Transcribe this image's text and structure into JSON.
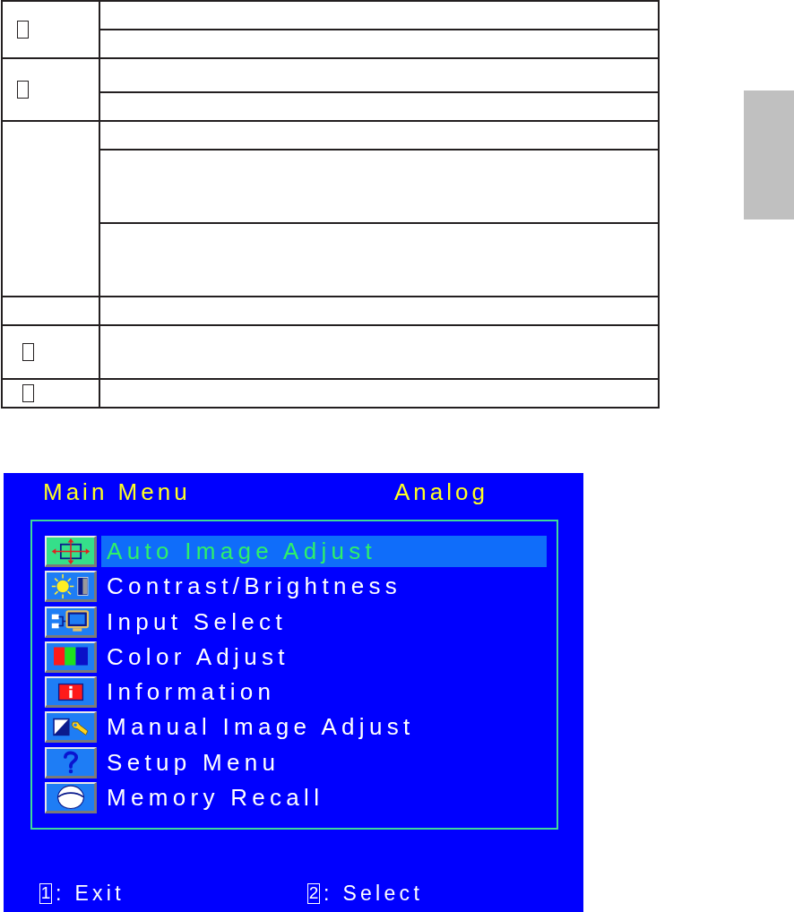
{
  "table": {
    "rows": [
      {
        "marker": true,
        "parts": [
          {
            "kind": "line"
          },
          {
            "kind": "line"
          }
        ]
      },
      {
        "marker": true,
        "parts": [
          {
            "kind": "line_tall"
          },
          {
            "kind": "line"
          }
        ]
      },
      {
        "marker": false,
        "parts": [
          {
            "kind": "line"
          },
          {
            "kind": "block_tall"
          },
          {
            "kind": "block_tall"
          }
        ]
      },
      {
        "marker": false,
        "parts": [
          {
            "kind": "line"
          }
        ]
      },
      {
        "marker": true,
        "parts": [
          {
            "kind": "block"
          }
        ]
      },
      {
        "marker": true,
        "parts": [
          {
            "kind": "line"
          }
        ]
      }
    ]
  },
  "osd_menu": {
    "title": "Main Menu",
    "source": "Analog",
    "items": [
      {
        "kind": "crosshair",
        "label": "Auto Image Adjust",
        "selected": true
      },
      {
        "kind": "sun",
        "label": "Contrast/Brightness",
        "selected": false
      },
      {
        "kind": "input",
        "label": "Input Select",
        "selected": false
      },
      {
        "kind": "colors",
        "label": "Color Adjust",
        "selected": false
      },
      {
        "kind": "info",
        "label": "Information",
        "selected": false
      },
      {
        "kind": "wrench",
        "label": "Manual Image Adjust",
        "selected": false
      },
      {
        "kind": "question",
        "label": "Setup Menu",
        "selected": false
      },
      {
        "kind": "helmet",
        "label": "Memory Recall",
        "selected": false
      }
    ],
    "footer": [
      {
        "key": "1",
        "label": ": Exit"
      },
      {
        "key": "2",
        "label": ": Select"
      }
    ]
  }
}
